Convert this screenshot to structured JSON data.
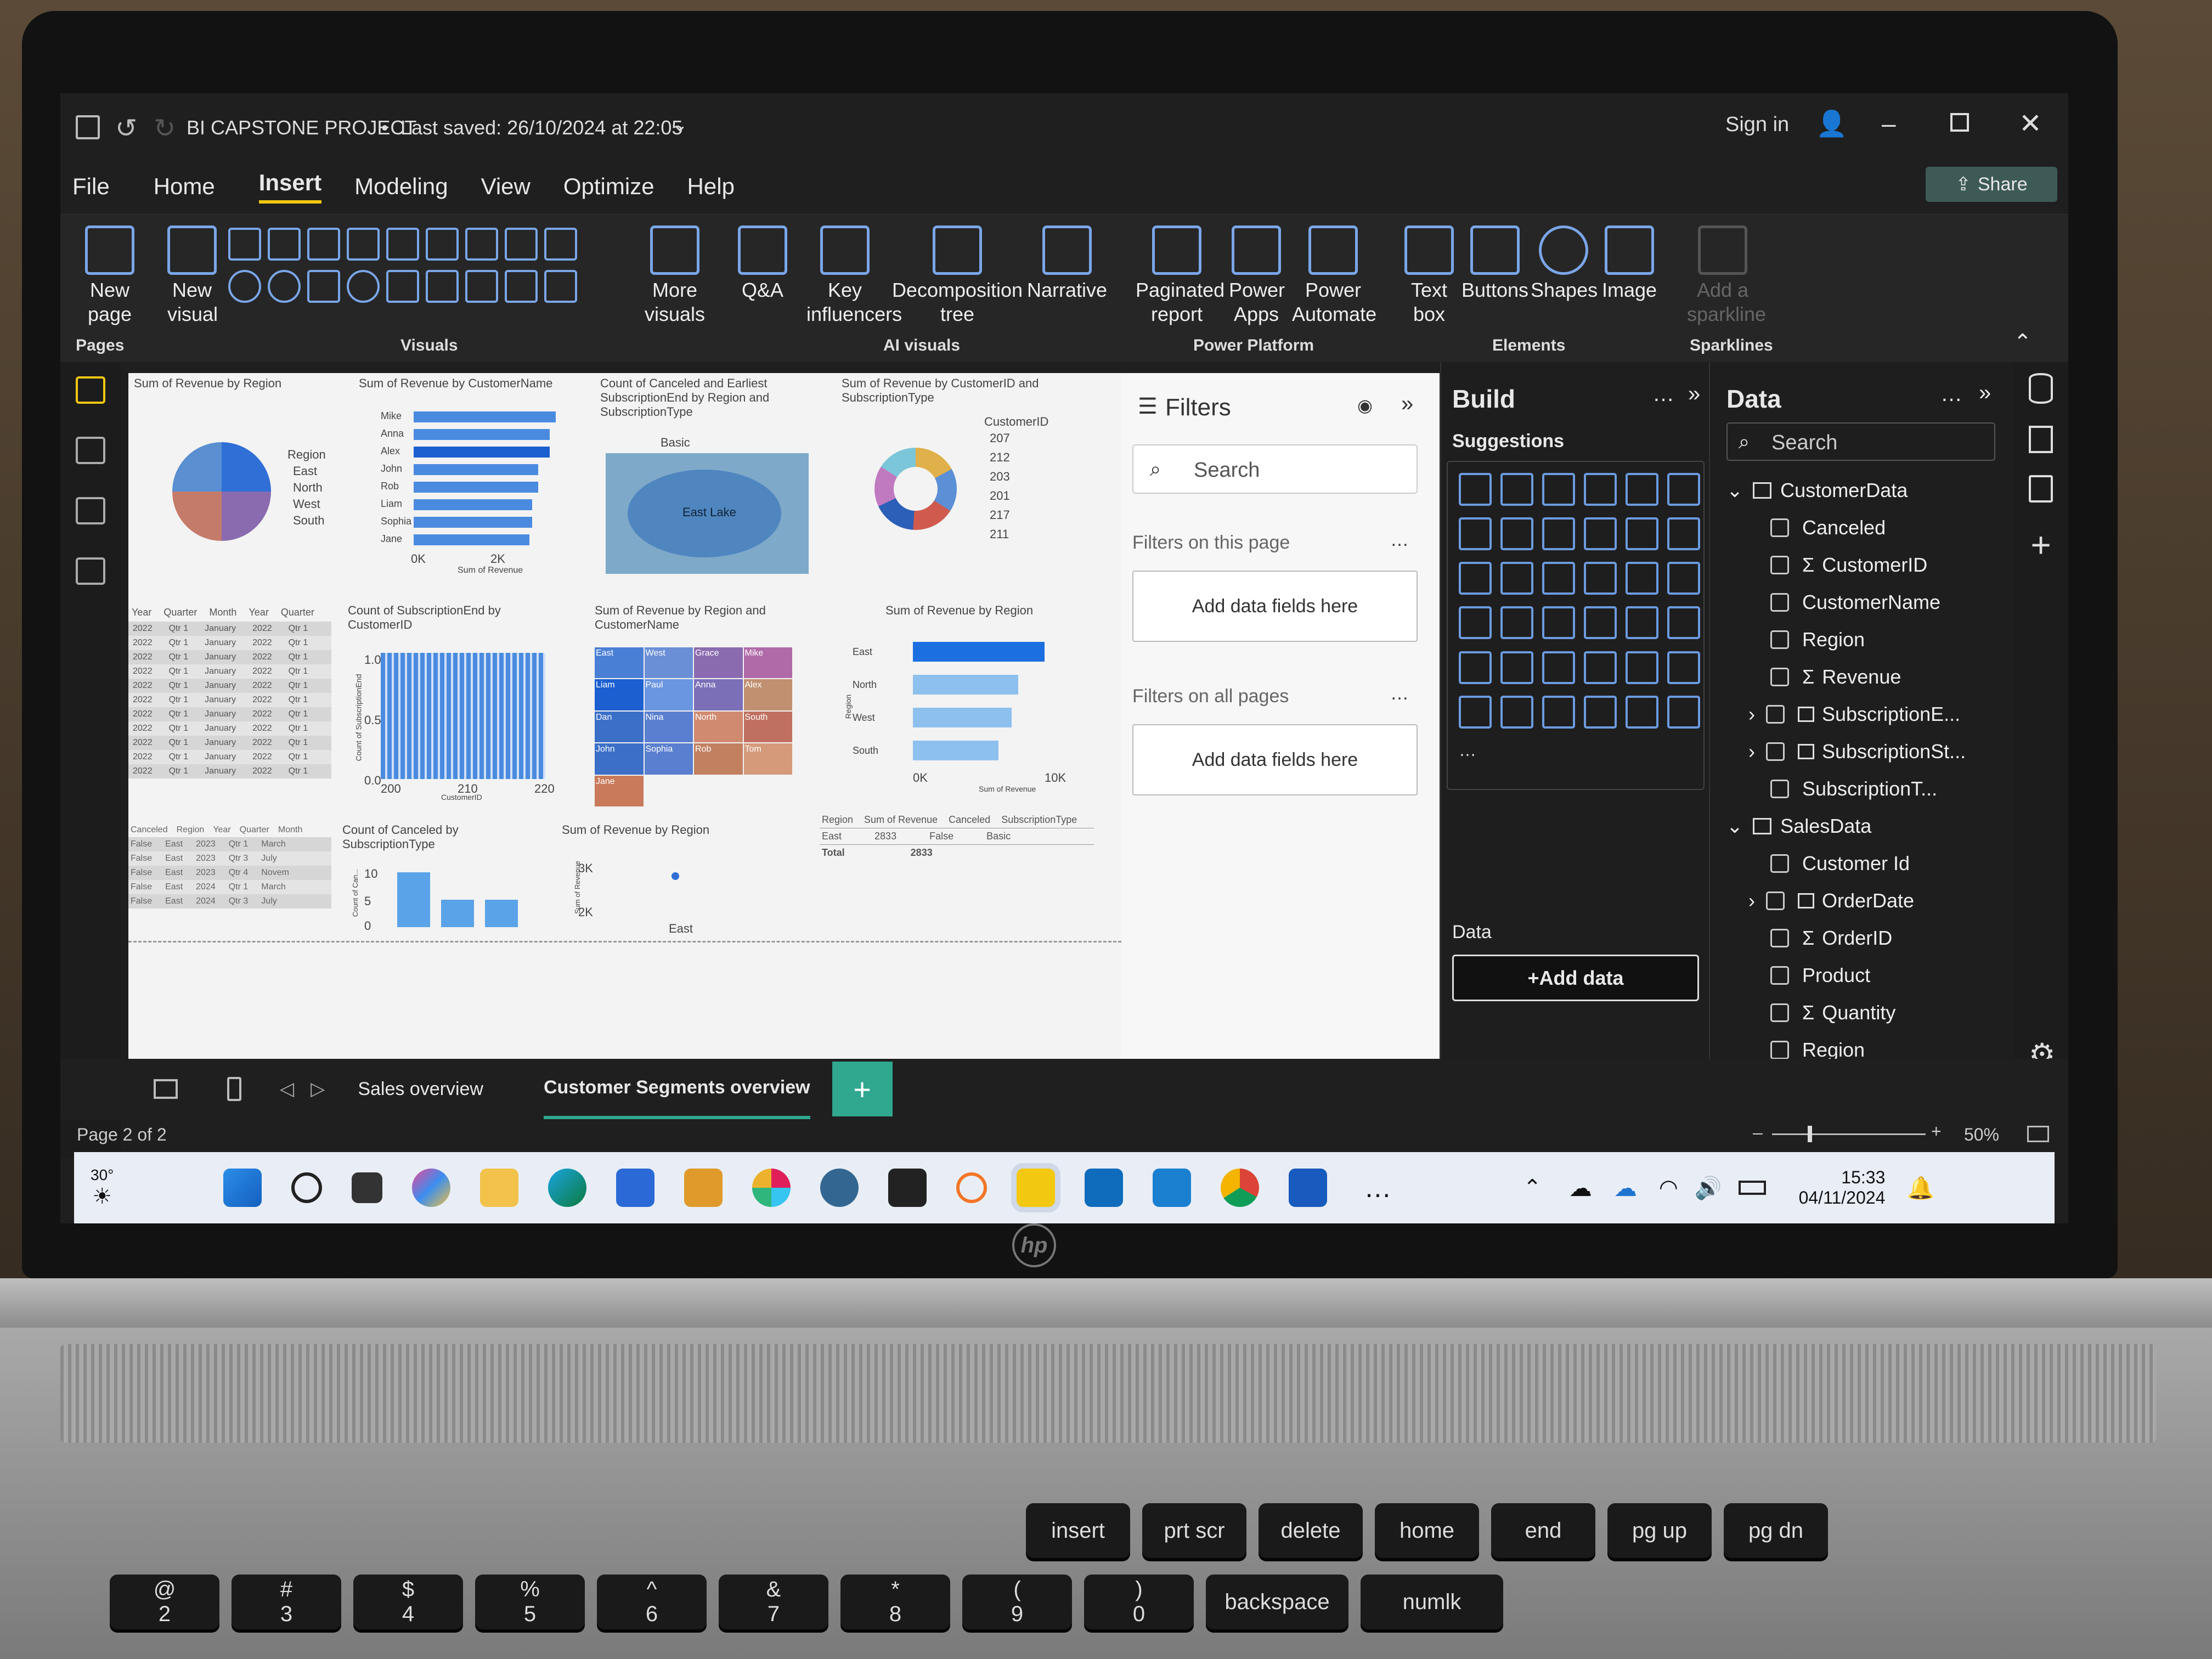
{
  "title": {
    "file": "BI CAPSTONE PROJECT",
    "separator": "•",
    "saved": "Last saved: 26/10/2024 at 22:05",
    "sign_in": "Sign in",
    "share": "Share"
  },
  "menu": [
    "File",
    "Home",
    "Insert",
    "Modeling",
    "View",
    "Optimize",
    "Help"
  ],
  "ribbon": {
    "new_page": "New page",
    "new_visual": "New visual",
    "pages_group": "Pages",
    "visuals_group": "Visuals",
    "more_visuals": "More visuals",
    "qa": "Q&A",
    "key_influencers": "Key influencers",
    "decomposition": "Decomposition tree",
    "narrative": "Narrative",
    "ai_group": "AI visuals",
    "paginated": "Paginated report",
    "power_apps": "Power Apps",
    "power_automate": "Power Automate",
    "pp_group": "Power Platform",
    "text_box": "Text box",
    "buttons": "Buttons",
    "shapes": "Shapes",
    "image": "Image",
    "elements_group": "Elements",
    "sparkline": "Add a sparkline",
    "sparklines_group": "Sparklines"
  },
  "canvas": {
    "v1": "Sum of Revenue by Region",
    "v1_legend": "Region",
    "v1_items": [
      "East",
      "North",
      "West",
      "South"
    ],
    "v2": "Sum of Revenue by CustomerName",
    "v2_names": [
      "Mike",
      "Anna",
      "Alex",
      "John",
      "Rob",
      "Liam",
      "Sophia",
      "Jane"
    ],
    "v2_x": [
      "0K",
      "2K"
    ],
    "v2_xlabel": "Sum of Revenue",
    "v3": "Count of Canceled and Earliest SubscriptionEnd by Region and SubscriptionType",
    "v3_legend": "Basic",
    "v3_lake": "East Lake",
    "v4": "Sum of Revenue by CustomerID and SubscriptionType",
    "v4_legend": "CustomerID",
    "v4_ids": [
      "207",
      "212",
      "203",
      "201",
      "217",
      "211"
    ],
    "v5_headers": [
      "Year",
      "Quarter",
      "Month",
      "Year",
      "Quarter"
    ],
    "v5_row": [
      "2022",
      "Qtr 1",
      "January",
      "2022",
      "Qtr 1"
    ],
    "v6": "Count of SubscriptionEnd by CustomerID",
    "v6_x": [
      "200",
      "210",
      "220"
    ],
    "v6_y": [
      "1.0",
      "0.5",
      "0.0"
    ],
    "v6_xlabel": "CustomerID",
    "v6_ylabel": "Count of SubscriptionEnd",
    "v7": "Sum of Revenue by Region and CustomerName",
    "v7_cells": [
      "East",
      "West",
      "Grace",
      "Mike",
      "Liam",
      "Paul",
      "Anna",
      "Alex",
      "Dan",
      "Nina",
      "North",
      "South",
      "John",
      "Sophia",
      "Rob",
      "Tom",
      "Jane"
    ],
    "v8": "Sum of Revenue by Region",
    "v8_cats": [
      "East",
      "North",
      "West",
      "South"
    ],
    "v8_x": [
      "0K",
      "10K"
    ],
    "v8_xlabel": "Sum of Revenue",
    "v8_ylabel": "Region",
    "v9_headers": [
      "Canceled",
      "Region",
      "Year",
      "Quarter",
      "Month"
    ],
    "v9_rows": [
      [
        "False",
        "East",
        "2023",
        "Qtr 1",
        "March"
      ],
      [
        "False",
        "East",
        "2023",
        "Qtr 3",
        "July"
      ],
      [
        "False",
        "East",
        "2023",
        "Qtr 4",
        "Novem"
      ],
      [
        "False",
        "East",
        "2024",
        "Qtr 1",
        "March"
      ],
      [
        "False",
        "East",
        "2024",
        "Qtr 3",
        "July"
      ]
    ],
    "v10": "Count of Canceled by SubscriptionType",
    "v10_y": [
      "10",
      "5",
      "0"
    ],
    "v10_ylabel": "Count of Can...",
    "v11": "Sum of Revenue by Region",
    "v11_y": [
      "3K",
      "2K"
    ],
    "v11_x": "East",
    "v11_ylabel": "Sum of Revenue",
    "v12_headers": [
      "Region",
      "Sum of Revenue",
      "Canceled",
      "SubscriptionType"
    ],
    "v12_row": [
      "East",
      "2833",
      "False",
      "Basic"
    ],
    "v12_total": [
      "Total",
      "2833"
    ]
  },
  "filters": {
    "title": "Filters",
    "search": "Search",
    "on_page": "Filters on this page",
    "add1": "Add data fields here",
    "on_all": "Filters on all pages",
    "add2": "Add data fields here"
  },
  "build": {
    "title": "Build",
    "suggestions": "Suggestions",
    "data_label": "Data",
    "add_data": "+Add data"
  },
  "data_pane": {
    "title": "Data",
    "search": "Search",
    "table1": "CustomerData",
    "t1_fields": [
      "Canceled",
      "CustomerID",
      "CustomerName",
      "Region",
      "Revenue",
      "SubscriptionE...",
      "SubscriptionSt...",
      "SubscriptionT..."
    ],
    "table2": "SalesData",
    "t2_fields": [
      "Customer Id",
      "OrderDate",
      "OrderID",
      "Product",
      "Quantity",
      "Region"
    ]
  },
  "tabs": {
    "t1": "Sales overview",
    "t2": "Customer Segments overview",
    "add": "+"
  },
  "status": {
    "page": "Page 2 of 2",
    "zoom": "50%"
  },
  "taskbar": {
    "weather": "30°",
    "time": "15:33",
    "date": "04/11/2024"
  },
  "keyboard": {
    "r1": [
      "insert",
      "prt scr",
      "delete",
      "home",
      "end",
      "pg up",
      "pg dn"
    ],
    "r2": [
      "@",
      "#",
      "$",
      "%",
      "^",
      "&",
      "*",
      "(",
      ")",
      "backspace",
      "numlk"
    ],
    "r2b": [
      "2",
      "3",
      "4",
      "5",
      "6",
      "7",
      "8",
      "9",
      "0"
    ]
  },
  "brand": "hp"
}
